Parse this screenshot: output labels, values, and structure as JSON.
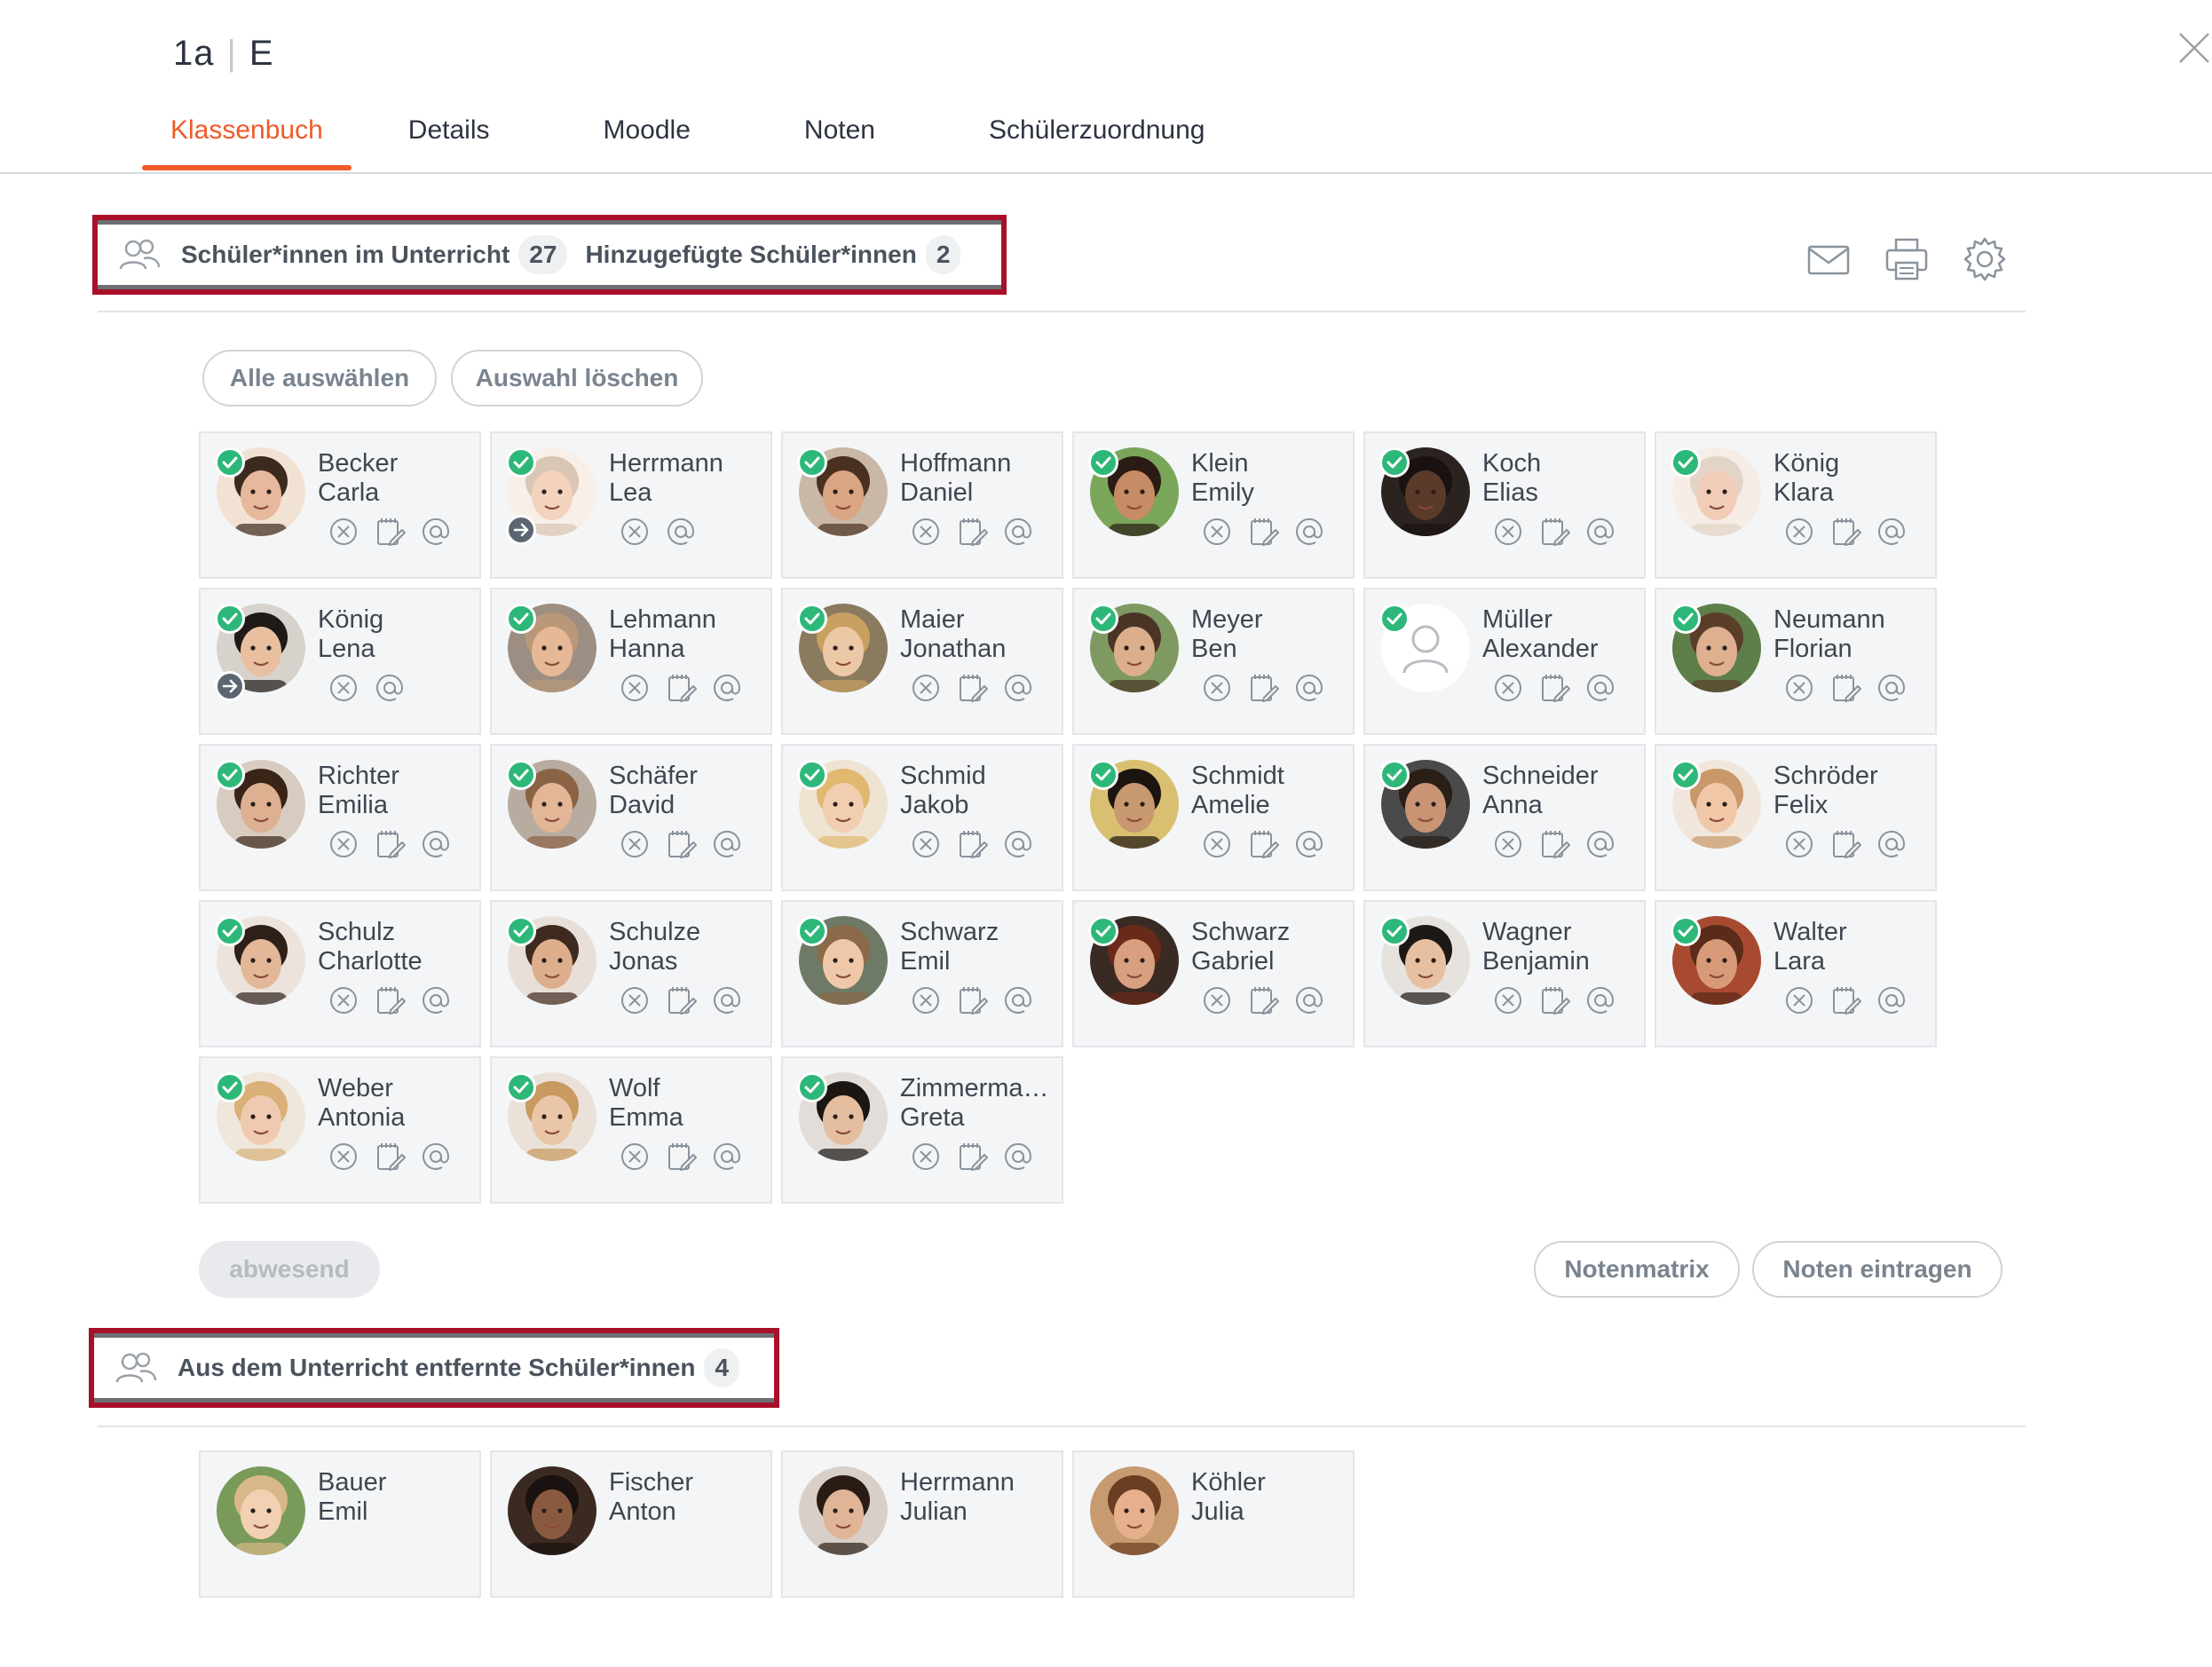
{
  "header": {
    "class_name": "1a",
    "subject": "E",
    "separator": "|"
  },
  "tabs": [
    "Klassenbuch",
    "Details",
    "Moodle",
    "Noten",
    "Schülerzuordnung"
  ],
  "active_tab": "Klassenbuch",
  "section_in_class": {
    "label": "Schüler*innen im Unterricht",
    "count": "27",
    "added_label": "Hinzugefügte Schüler*innen",
    "added_count": "2"
  },
  "toolbar_icons": [
    "mail-icon",
    "print-icon",
    "settings-icon"
  ],
  "selection": {
    "select_all": "Alle auswählen",
    "clear_selection": "Auswahl löschen"
  },
  "students": [
    {
      "last": "Becker",
      "first": "Carla",
      "checked": true,
      "moved": false,
      "actions": [
        "absent",
        "note",
        "mail"
      ],
      "skin": "#e6b89c",
      "hair": "#3b2a1e",
      "bg": "#f2e2d4"
    },
    {
      "last": "Herrmann",
      "first": "Lea",
      "checked": true,
      "moved": true,
      "actions": [
        "absent",
        "mail"
      ],
      "skin": "#f3d2be",
      "hair": "#d9c6b4",
      "bg": "#f7efe8"
    },
    {
      "last": "Hoffmann",
      "first": "Daniel",
      "checked": true,
      "moved": false,
      "actions": [
        "absent",
        "note",
        "mail"
      ],
      "skin": "#d9a582",
      "hair": "#4a3020",
      "bg": "#c9b8a8"
    },
    {
      "last": "Klein",
      "first": "Emily",
      "checked": true,
      "moved": false,
      "actions": [
        "absent",
        "note",
        "mail"
      ],
      "skin": "#c58c66",
      "hair": "#2a1c14",
      "bg": "#7aa65a"
    },
    {
      "last": "Koch",
      "first": "Elias",
      "checked": true,
      "moved": false,
      "actions": [
        "absent",
        "note",
        "mail"
      ],
      "skin": "#5a3a28",
      "hair": "#1a1210",
      "bg": "#2b2320"
    },
    {
      "last": "König",
      "first": "Klara",
      "checked": true,
      "moved": false,
      "actions": [
        "absent",
        "note",
        "mail"
      ],
      "skin": "#f1cdb8",
      "hair": "#e3d4c8",
      "bg": "#f6ede7"
    },
    {
      "last": "König",
      "first": "Lena",
      "checked": true,
      "moved": true,
      "actions": [
        "absent",
        "mail"
      ],
      "skin": "#e8c0a0",
      "hair": "#1e1a18",
      "bg": "#d8d2cc"
    },
    {
      "last": "Lehmann",
      "first": "Hanna",
      "checked": true,
      "moved": false,
      "actions": [
        "absent",
        "note",
        "mail"
      ],
      "skin": "#e6b898",
      "hair": "#b89878",
      "bg": "#9c8e82"
    },
    {
      "last": "Maier",
      "first": "Jonathan",
      "checked": true,
      "moved": false,
      "actions": [
        "absent",
        "note",
        "mail"
      ],
      "skin": "#edc8a6",
      "hair": "#c8a060",
      "bg": "#8a7a5e"
    },
    {
      "last": "Meyer",
      "first": "Ben",
      "checked": true,
      "moved": false,
      "actions": [
        "absent",
        "note",
        "mail"
      ],
      "skin": "#dcae8c",
      "hair": "#4a3426",
      "bg": "#7e9a62"
    },
    {
      "last": "Müller",
      "first": "Alexander",
      "checked": true,
      "moved": false,
      "actions": [
        "absent",
        "note",
        "mail"
      ],
      "placeholder": true,
      "skin": "#ffffff",
      "hair": "#ffffff",
      "bg": "#ffffff"
    },
    {
      "last": "Neumann",
      "first": "Florian",
      "checked": true,
      "moved": false,
      "actions": [
        "absent",
        "note",
        "mail"
      ],
      "skin": "#deb090",
      "hair": "#5a3e2a",
      "bg": "#5e7e4a"
    },
    {
      "last": "Richter",
      "first": "Emilia",
      "checked": true,
      "moved": false,
      "actions": [
        "absent",
        "note",
        "mail"
      ],
      "skin": "#dcb090",
      "hair": "#3a2418",
      "bg": "#d8cbc0"
    },
    {
      "last": "Schäfer",
      "first": "David",
      "checked": true,
      "moved": false,
      "actions": [
        "absent",
        "note",
        "mail"
      ],
      "skin": "#e2b696",
      "hair": "#8a6244",
      "bg": "#b8aba0"
    },
    {
      "last": "Schmid",
      "first": "Jakob",
      "checked": true,
      "moved": false,
      "actions": [
        "absent",
        "note",
        "mail"
      ],
      "skin": "#f1ceb0",
      "hair": "#e0b870",
      "bg": "#efe3d2"
    },
    {
      "last": "Schmidt",
      "first": "Amelie",
      "checked": true,
      "moved": false,
      "actions": [
        "absent",
        "note",
        "mail"
      ],
      "skin": "#c89870",
      "hair": "#1c1410",
      "bg": "#d9c070"
    },
    {
      "last": "Schneider",
      "first": "Anna",
      "checked": true,
      "moved": false,
      "actions": [
        "absent",
        "note",
        "mail"
      ],
      "skin": "#c89474",
      "hair": "#2a1e16",
      "bg": "#4a4a4a"
    },
    {
      "last": "Schröder",
      "first": "Felix",
      "checked": true,
      "moved": false,
      "actions": [
        "absent",
        "note",
        "mail"
      ],
      "skin": "#f0c8a8",
      "hair": "#c8986a",
      "bg": "#f0e6dc"
    },
    {
      "last": "Schulz",
      "first": "Charlotte",
      "checked": true,
      "moved": false,
      "actions": [
        "absent",
        "note",
        "mail"
      ],
      "skin": "#e2b898",
      "hair": "#2e2018",
      "bg": "#ece4dc"
    },
    {
      "last": "Schulze",
      "first": "Jonas",
      "checked": true,
      "moved": false,
      "actions": [
        "absent",
        "note",
        "mail"
      ],
      "skin": "#dcae8c",
      "hair": "#3e2a1e",
      "bg": "#e8e0d8"
    },
    {
      "last": "Schwarz",
      "first": "Emil",
      "checked": true,
      "moved": false,
      "actions": [
        "absent",
        "note",
        "mail"
      ],
      "skin": "#eec8a8",
      "hair": "#8a6a48",
      "bg": "#6e7a66"
    },
    {
      "last": "Schwarz",
      "first": "Gabriel",
      "checked": true,
      "moved": false,
      "actions": [
        "absent",
        "note",
        "mail"
      ],
      "skin": "#d8a080",
      "hair": "#6a2a1a",
      "bg": "#3a2a24"
    },
    {
      "last": "Wagner",
      "first": "Benjamin",
      "checked": true,
      "moved": false,
      "actions": [
        "absent",
        "note",
        "mail"
      ],
      "skin": "#e6c0a0",
      "hair": "#1e1814",
      "bg": "#e6e2de"
    },
    {
      "last": "Walter",
      "first": "Lara",
      "checked": true,
      "moved": false,
      "actions": [
        "absent",
        "note",
        "mail"
      ],
      "skin": "#d89a78",
      "hair": "#5a2a1a",
      "bg": "#a84a30"
    },
    {
      "last": "Weber",
      "first": "Antonia",
      "checked": true,
      "moved": false,
      "actions": [
        "absent",
        "note",
        "mail"
      ],
      "skin": "#f0cab0",
      "hair": "#d8b078",
      "bg": "#efe6dc"
    },
    {
      "last": "Wolf",
      "first": "Emma",
      "checked": true,
      "moved": false,
      "actions": [
        "absent",
        "note",
        "mail"
      ],
      "skin": "#eac6a8",
      "hair": "#c89a60",
      "bg": "#eae2d8"
    },
    {
      "last": "Zimmerma…",
      "first": "Greta",
      "checked": true,
      "moved": false,
      "actions": [
        "absent",
        "note",
        "mail"
      ],
      "skin": "#e4be9e",
      "hair": "#1c1612",
      "bg": "#e2ddd8"
    }
  ],
  "footer_actions": {
    "absent": "abwesend",
    "grade_matrix": "Notenmatrix",
    "enter_grades": "Noten eintragen"
  },
  "section_removed": {
    "label": "Aus dem Unterricht entfernte Schüler*innen",
    "count": "4"
  },
  "removed_students": [
    {
      "last": "Bauer",
      "first": "Emil",
      "skin": "#f2d0b4",
      "hair": "#d8b888",
      "bg": "#7a9a5a"
    },
    {
      "last": "Fischer",
      "first": "Anton",
      "skin": "#8a5a40",
      "hair": "#1a1210",
      "bg": "#3a2a22"
    },
    {
      "last": "Herrmann",
      "first": "Julian",
      "skin": "#e0b496",
      "hair": "#2a1c14",
      "bg": "#d8d0c8"
    },
    {
      "last": "Köhler",
      "first": "Julia",
      "skin": "#e6b08c",
      "hair": "#6a3e22",
      "bg": "#c89a70"
    }
  ],
  "colors": {
    "accent": "#f05a28",
    "check_green": "#2db87a",
    "highlight_box": "#a8102a",
    "card_bg": "#f4f5f7"
  }
}
